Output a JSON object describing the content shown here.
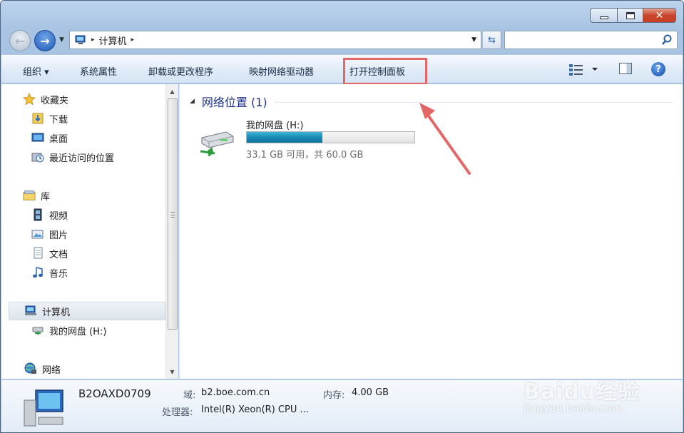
{
  "window": {
    "caption": {
      "minimize": "",
      "maximize": "",
      "close": "✕"
    }
  },
  "address_bar": {
    "path": [
      "计算机"
    ],
    "separator": "▸"
  },
  "search": {
    "placeholder": "",
    "value": ""
  },
  "toolbar": {
    "organize": "组织 ▾",
    "system_properties": "系统属性",
    "uninstall": "卸载或更改程序",
    "map_network_drive": "映射网络驱动器",
    "open_control_panel": "打开控制面板",
    "view_menu": "▾",
    "help": "?"
  },
  "nav_pane": {
    "favorites": {
      "label": "收藏夹",
      "items": [
        "下载",
        "桌面",
        "最近访问的位置"
      ]
    },
    "libraries": {
      "label": "库",
      "items": [
        "视频",
        "图片",
        "文档",
        "音乐"
      ]
    },
    "computer": {
      "label": "计算机",
      "items": [
        "我的网盘 (H:)"
      ]
    },
    "network": {
      "label": "网络"
    }
  },
  "content": {
    "group": {
      "title": "网络位置 (1)"
    },
    "drive": {
      "name": "我的网盘 (H:)",
      "free_text": "33.1 GB 可用，共 60.0 GB",
      "used_fraction": 0.45
    }
  },
  "details": {
    "computer_name": "B2OAXD0709",
    "domain_label": "域:",
    "domain_value": "b2.boe.com.cn",
    "memory_label": "内存:",
    "memory_value": "4.00 GB",
    "cpu_label": "处理器:",
    "cpu_value": "Intel(R) Xeon(R) CPU ..."
  },
  "watermark": {
    "brand": "Baidu经验",
    "url": "jingyan.baidu.com"
  },
  "colors": {
    "highlight": "#e26766",
    "link_title": "#1e3287",
    "progress": "#1a8ab5"
  },
  "icons": [
    "back-icon",
    "forward-icon",
    "computer-icon",
    "refresh-icon",
    "search-icon",
    "star-icon",
    "folder-icon",
    "desktop-icon",
    "recent-icon",
    "library-icon",
    "video-icon",
    "picture-icon",
    "document-icon",
    "music-icon",
    "network-drive-icon",
    "network-icon",
    "help-icon"
  ]
}
